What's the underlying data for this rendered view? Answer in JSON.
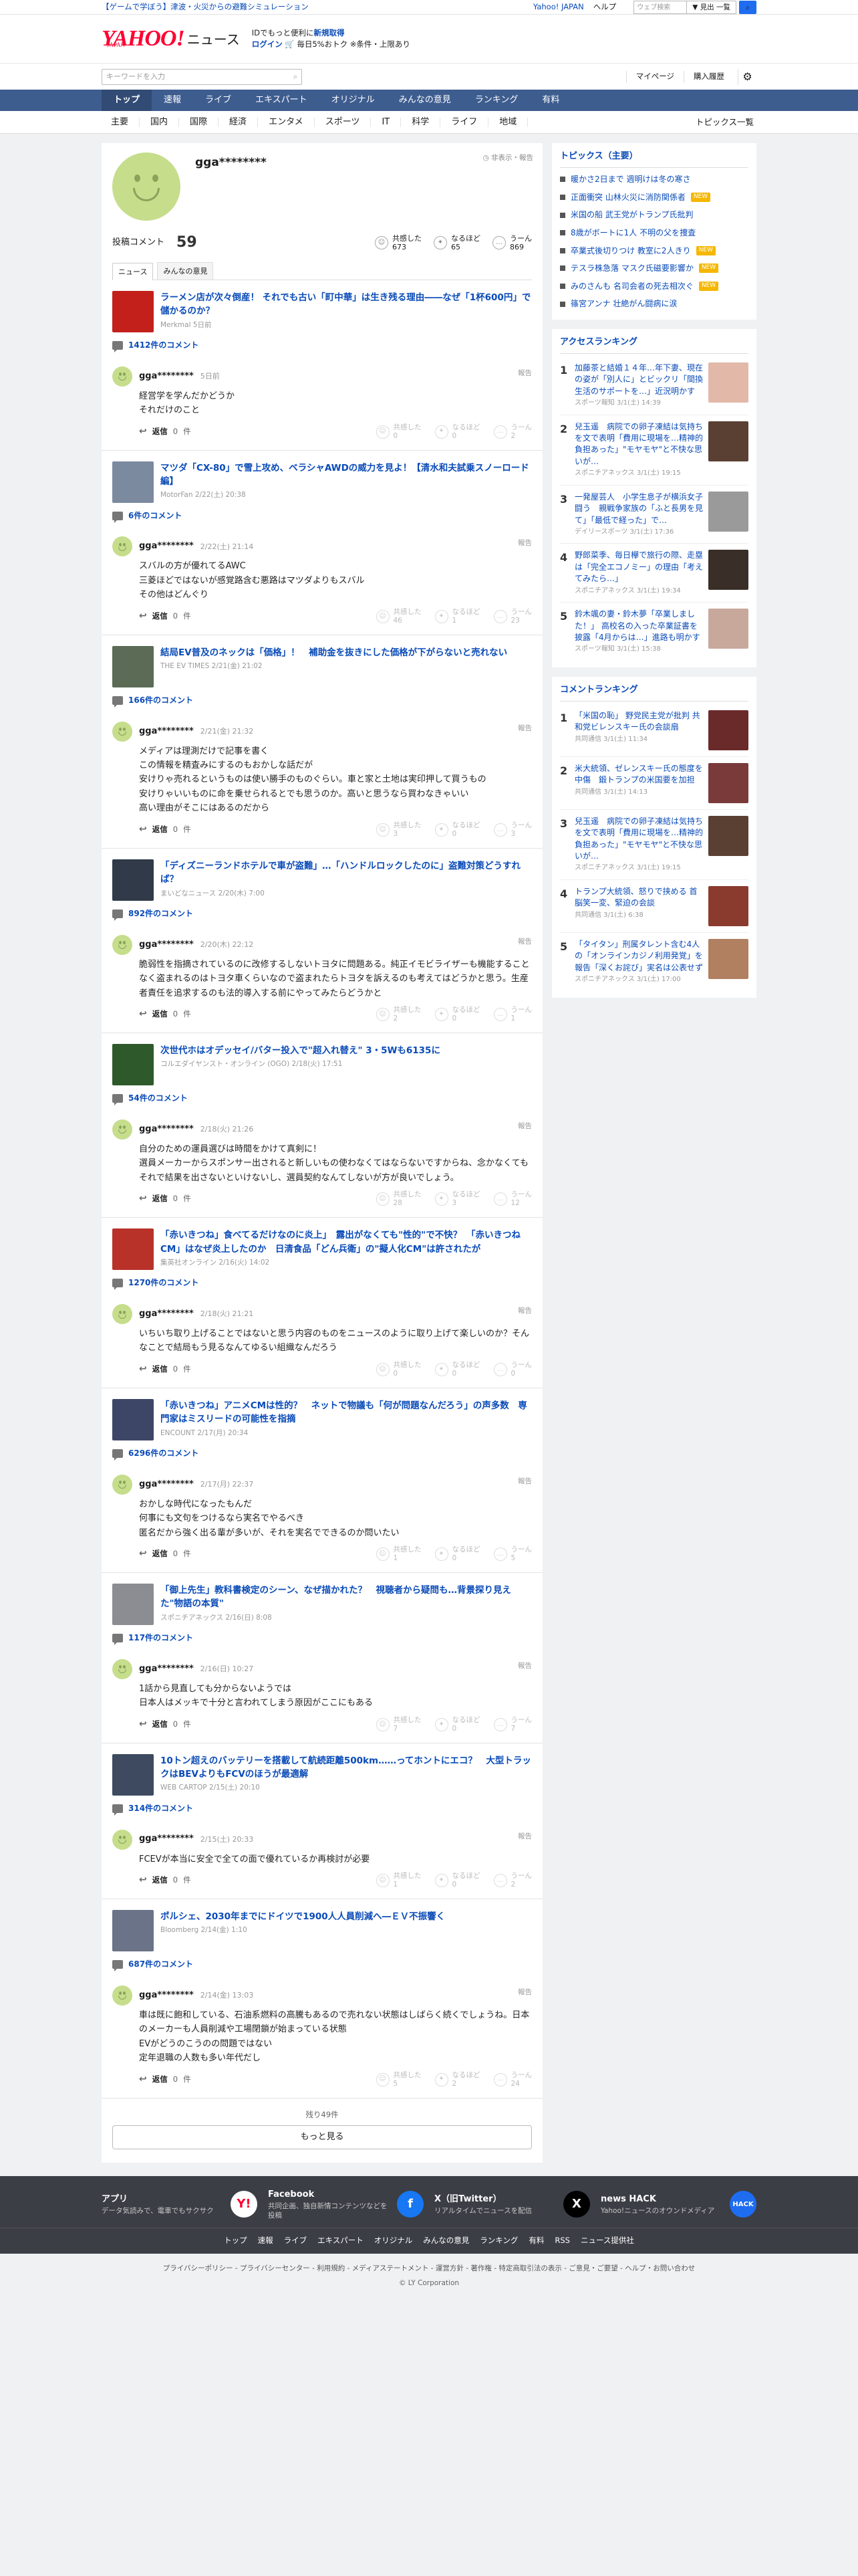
{
  "topbar": {
    "promo": "【ゲームで学ぼう】津波・火災からの避難シミュレーション",
    "links": [
      "Yahoo! JAPAN",
      "ヘルプ"
    ],
    "search_placeholder": "ウェブ検索",
    "search_button": "▼ 見出 一覧"
  },
  "header": {
    "logo_main": "YAHOO!",
    "logo_sub": "JAPAN",
    "logo_section": "ニュース",
    "promo_line1a": "IDでもっと便利に",
    "promo_line1b": "新規取得",
    "login": "ログイン",
    "promo_line2": "毎日5%おトク ※条件・上限あり"
  },
  "searchrow": {
    "placeholder": "キーワードを入力",
    "mypage": "マイページ",
    "history": "購入履歴"
  },
  "mainnav": [
    "トップ",
    "速報",
    "ライブ",
    "エキスパート",
    "オリジナル",
    "みんなの意見",
    "ランキング",
    "有料"
  ],
  "subnav": [
    "主要",
    "国内",
    "国際",
    "経済",
    "エンタメ",
    "スポーツ",
    "IT",
    "科学",
    "ライフ",
    "地域"
  ],
  "subnav_all": "トピックス一覧",
  "profile": {
    "name": "gga********",
    "notice": "非表示・報告",
    "count_label": "投稿コメント",
    "count": "59",
    "reactions": [
      {
        "label": "共感した",
        "count": "673"
      },
      {
        "label": "なるほど",
        "count": "65"
      },
      {
        "label": "うーん",
        "count": "869"
      }
    ],
    "tabs": [
      "ニュース",
      "みんなの意見"
    ]
  },
  "articles": [
    {
      "title": "ラーメン店が次々倒産！ それでも古い「町中華」は生き残る理由――なぜ「1杯600円」で儲かるのか？",
      "src": "Merkmal 5日前",
      "ccount": "1412件のコメント",
      "date": "5日前",
      "text": "経営学を学んだかどうか\nそれだけのこと",
      "replies": "0",
      "r": [
        "0",
        "0",
        "2"
      ],
      "thumb": "#c3201b"
    },
    {
      "title": "マツダ「CX-80」で雪上攻め、ベラシャAWDの威力を見よ！【清水和夫試乗スノーロード編】",
      "src": "MotorFan 2/22(土) 20:38",
      "ccount": "6件のコメント",
      "date": "2/22(土) 21:14",
      "text": "スバルの方が優れてるAWC\n三菱ほどではないが感覚路含む悪路はマツダよりもスバル\nその他はどんぐり",
      "replies": "0",
      "r": [
        "46",
        "1",
        "23"
      ],
      "thumb": "#7c8aa0"
    },
    {
      "title": "結局EV普及のネックは「価格」！　補助金を抜きにした価格が下がらないと売れない",
      "src": "THE EV TIMES 2/21(金) 21:02",
      "ccount": "166件のコメント",
      "date": "2/21(金) 21:32",
      "text": "メディアは理測だけで記事を書く\nこの情報を精査みにするのもおかしな話だが\n安けりゃ売れるというものは使い勝手のものぐらい。車と家と土地は実印押して買うもの\n安けりゃいいものに命を乗せられるとでも思うのか。高いと思うなら買わなきゃいい\n高い理由がそこにはあるのだから",
      "replies": "0",
      "r": [
        "3",
        "0",
        "3"
      ],
      "thumb": "#5b6b55"
    },
    {
      "title": "「ディズニーランドホテルで車が盗難」…「ハンドルロックしたのに」盗難対策どうすれば？",
      "src": "まいどなニュース 2/20(木) 7:00",
      "ccount": "892件のコメント",
      "date": "2/20(木) 22:12",
      "text": "脆弱性を指摘されているのに改修するしないトヨタに問題ある。純正イモビライザーも機能することなく盗まれるのはトヨタ車くらいなので盗まれたらトヨタを訴えるのも考えてはどうかと思う。生産者責任を追求するのも法的導入する前にやってみたらどうかと",
      "replies": "0",
      "r": [
        "2",
        "0",
        "1"
      ],
      "thumb": "#303a48"
    },
    {
      "title": "次世代ホはオデッセイ/バター投入で\"超入れ替え\" 3・5Wも6135に",
      "src": "コルエダイヤンスト・オンライン (OGO) 2/18(火) 17:51",
      "ccount": "54件のコメント",
      "date": "2/18(火) 21:26",
      "text": "自分のための運員選びは時間をかけて真剣に！\n選員メーカーからスポンサー出されると新しいもの使わなくてはならないですからね、念かなくてもそれで結果を出さないといけないし、選員契約なんてしないが方が良いでしょう。",
      "replies": "0",
      "r": [
        "28",
        "3",
        "12"
      ],
      "thumb": "#2e5a2b"
    },
    {
      "title": "「赤いきつね」食べてるだけなのに炎上」　露出がなくても\"性的\"で不快？　「赤いきつねCM」はなぜ炎上したのか　日清食品「どん兵衛」の\"擬人化CM\"は許されたが",
      "src": "集英社オンライン 2/16(火) 14:02",
      "ccount": "1270件のコメント",
      "date": "2/18(火) 21:21",
      "text": "いちいち取り上げることではないと思う内容のものをニュースのように取り上げて楽しいのか？そんなことで結局もう見るなんてゆるい組織なんだろう",
      "replies": "0",
      "r": [
        "0",
        "0",
        "0"
      ],
      "thumb": "#b8322a"
    },
    {
      "title": "「赤いきつね」アニメCMは性的？　ネットで物議も「何が問題なんだろう」の声多数　専門家はミスリードの可能性を指摘",
      "src": "ENCOUNT 2/17(月) 20:34",
      "ccount": "6296件のコメント",
      "date": "2/17(月) 22:37",
      "text": "おかしな時代になったもんだ\n何事にも文句をつけるなら実名でやるべき\n匿名だから強く出る輩が多いが、それを実名でできるのか問いたい",
      "replies": "0",
      "r": [
        "1",
        "0",
        "5"
      ],
      "thumb": "#3e4668"
    },
    {
      "title": "「御上先生」教科書検定のシーン、なぜ描かれた？　視聴者から疑問も…背景探り見えた\"物語の本質\"",
      "src": "スポニチアネックス 2/16(日) 8:08",
      "ccount": "117件のコメント",
      "date": "2/16(日) 10:27",
      "text": "1話から見直しても分からないようでは\n日本人はメッキで十分と言われてしまう原因がここにもある",
      "replies": "0",
      "r": [
        "7",
        "0",
        "7"
      ],
      "thumb": "#8b8d92"
    },
    {
      "title": "10トン超えのバッテリーを搭載して航続距離500km……ってホントにエコ？　大型トラックはBEVよりもFCVのほうが最適解",
      "src": "WEB CARTOP 2/15(土) 20:10",
      "ccount": "314件のコメント",
      "date": "2/15(土) 20:33",
      "text": "FCEVが本当に安全で全ての面で優れているか再検討が必要",
      "replies": "0",
      "r": [
        "1",
        "0",
        "2"
      ],
      "thumb": "#3d4a60"
    },
    {
      "title": "ポルシェ、2030年までにドイツで1900人人員削減へ―ＥＶ不振響く",
      "src": "Bloomberg 2/14(金) 1:10",
      "ccount": "687件のコメント",
      "date": "2/14(金) 13:03",
      "text": "車は既に飽和している、石油系燃料の高騰もあるので売れない状態はしばらく続くでしょうね。日本のメーカーも人員削減や工場閉鎖が始まっている状態\nEVがどうのこうのの問題ではない\n定年退職の人数も多い年代だし",
      "replies": "0",
      "r": [
        "5",
        "2",
        "24"
      ],
      "thumb": "#6b7388"
    }
  ],
  "remaining": "残り49件",
  "more_button": "もっと見る",
  "reply_label": "返信",
  "reply_suffix": "件",
  "report_label": "報告",
  "reaction_labels": [
    "共感した",
    "なるほど",
    "うーん"
  ],
  "sidebar": {
    "topics_title": "トピックス（主要）",
    "topics": [
      {
        "text": "暖かさ2日まで 週明けは冬の寒さ",
        "badge": ""
      },
      {
        "text": "正面衝突 山林火災に消防関係者",
        "badge": "NEW"
      },
      {
        "text": "米国の船 武王党がトランプ氏批判",
        "badge": ""
      },
      {
        "text": "8歳がボートに1人 不明の父を捜査",
        "badge": ""
      },
      {
        "text": "卒業式後切りつけ 教室に2人きり",
        "badge": "NEW"
      },
      {
        "text": "テスラ株急落 マスク氏磁要影響か",
        "badge": "NEW"
      },
      {
        "text": "みのさんも 名司会者の死去相次ぐ",
        "badge": "NEW"
      },
      {
        "text": "篠宮アンナ 壮絶がん闘病に涙",
        "badge": ""
      }
    ],
    "access_title": "アクセスランキング",
    "access": [
      {
        "text": "加藤茶と結婚１４年…年下妻、現在の姿が「別人に」とビックリ「間換生活のサポートを…」近況明かす",
        "src": "スポーツ報知 3/1(土) 14:39",
        "color": "#e2b8a8"
      },
      {
        "text": "兒玉遥　病院での卵子凍結は気持ちを文で表明「費用に現場を…精神的負担あった」\"モヤモヤ\"と不快な思いが…",
        "src": "スポニチアネックス 3/1(土) 19:15",
        "color": "#5a3f33"
      },
      {
        "text": "一発屋芸人　小学生息子が横浜女子闘う　親戦争家族の「ふと長男を見て」「最低で経った」で…",
        "src": "デイリースポーツ 3/1(土) 17:36",
        "color": "#9a9a9a"
      },
      {
        "text": "野郎菜季、毎日欅で旅行の際、走塁は「完全エコノミー」の理由「考えてみたら…」",
        "src": "スポニチアネックス 3/1(土) 19:34",
        "color": "#3a2f28"
      },
      {
        "text": "鈴木颯の妻・鈴木夢「卒業しました！」 高校名の入った卒業証書を披露「4月からは…」進路も明かす",
        "src": "スポーツ報知 3/1(土) 15:38",
        "color": "#c9a89c"
      }
    ],
    "comment_title": "コメントランキング",
    "comments": [
      {
        "text": "「米国の恥」 野党民主党が批判 共和党ビレンスキー氏の会談扇",
        "src": "共同通信 3/1(土) 11:34",
        "color": "#6b2a2a"
      },
      {
        "text": "米大統領、ゼレンスキー氏の態度を中傷　鍛トランプの米国要を加担",
        "src": "共同通信 3/1(土) 14:13",
        "color": "#7a3a3a"
      },
      {
        "text": "兒玉遥　病院での卵子凍結は気持ちを文で表明「費用に現場を…精神的負担あった」\"モヤモヤ\"と不快な思いが…",
        "src": "スポニチアネックス 3/1(土) 19:15",
        "color": "#5a3f33"
      },
      {
        "text": "トランプ大統領、怒りで挟める 首脳笑一変、緊迫の会談",
        "src": "共同通信 3/1(土) 6:38",
        "color": "#8a3b2e"
      },
      {
        "text": "「タイタン」刑属タレント含む4人の「オンラインカジノ利用発覚」を報告「深くお詫び」実名は公表せず",
        "src": "スポニチアネックス 3/1(土) 17:00",
        "color": "#b08060"
      }
    ]
  },
  "footer": {
    "cards": [
      {
        "title": "アプリ",
        "desc": "データ気読みで、電車でもサクサク",
        "icon": "Y!"
      },
      {
        "title": "Facebook",
        "desc": "共同企画、独自新情コンテンツなどを投稿",
        "icon": "f"
      },
      {
        "title": "X（旧Twitter）",
        "desc": "リアルタイムでニュースを配信",
        "icon": "X"
      },
      {
        "title": "news HACK",
        "desc": "Yahoo!ニュースのオウンドメディア",
        "icon": "HACK"
      }
    ],
    "links": [
      "トップ",
      "速報",
      "ライブ",
      "エキスパート",
      "オリジナル",
      "みんなの意見",
      "ランキング",
      "有料",
      "RSS",
      "ニュース提供社"
    ],
    "legal": "プライバシーポリシー - プライバシーセンター - 利用規約 - メディアステートメント - 運営方針 - 著作権 - 特定商取引法の表示 - ご意見・ご要望 - ヘルプ・お問い合わせ",
    "copyright": "© LY Corporation"
  }
}
